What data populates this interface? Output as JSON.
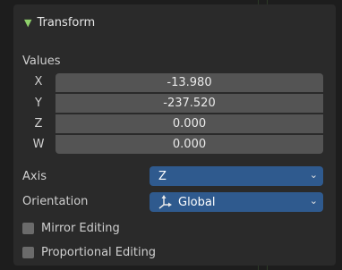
{
  "panel": {
    "title": "Transform",
    "values_label": "Values",
    "vector": [
      {
        "axis": "X",
        "value": "-13.980"
      },
      {
        "axis": "Y",
        "value": "-237.520"
      },
      {
        "axis": "Z",
        "value": "0.000"
      },
      {
        "axis": "W",
        "value": "0.000"
      }
    ],
    "axis": {
      "label": "Axis",
      "value": "Z"
    },
    "orientation": {
      "label": "Orientation",
      "value": "Global",
      "icon": "transform-orientation-icon"
    },
    "mirror_editing": {
      "label": "Mirror Editing",
      "checked": false
    },
    "proportional_editing": {
      "label": "Proportional Editing",
      "checked": false
    }
  },
  "colors": {
    "panel_bg": "#2a2a2a",
    "field_bg": "#545454",
    "select_bg": "#2f5a8e",
    "accent_green": "#8fd16b"
  }
}
